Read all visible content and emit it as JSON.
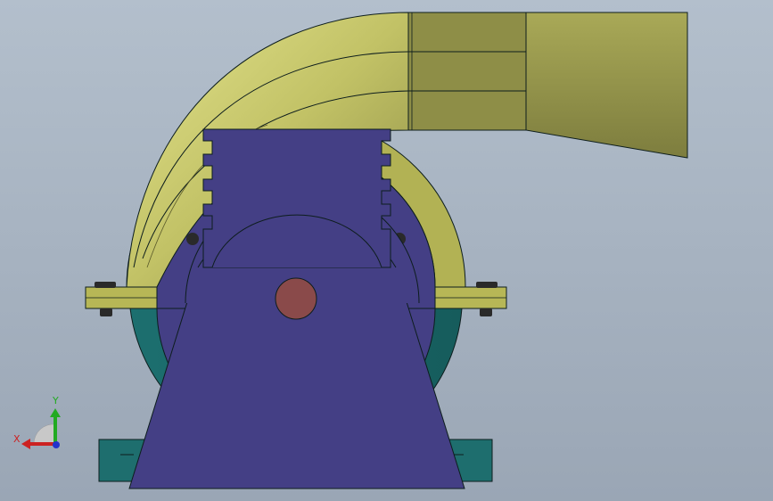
{
  "view": {
    "background_top": "#b3bfcc",
    "background_bottom": "#9aa6b5"
  },
  "model": {
    "parts": [
      {
        "name": "outlet-duct",
        "color": "#b8b858"
      },
      {
        "name": "volute-casing",
        "color": "#b0b050"
      },
      {
        "name": "bearing-housing",
        "color": "#443f85"
      },
      {
        "name": "lower-casing",
        "color": "#1e6e6e"
      },
      {
        "name": "shaft",
        "color": "#8a4a4a"
      },
      {
        "name": "base",
        "color": "#1e6e6e"
      }
    ]
  },
  "triad": {
    "x_label": "X",
    "y_label": "Y",
    "x_color": "#cc2222",
    "y_color": "#22aa22",
    "z_color": "#2233cc"
  }
}
